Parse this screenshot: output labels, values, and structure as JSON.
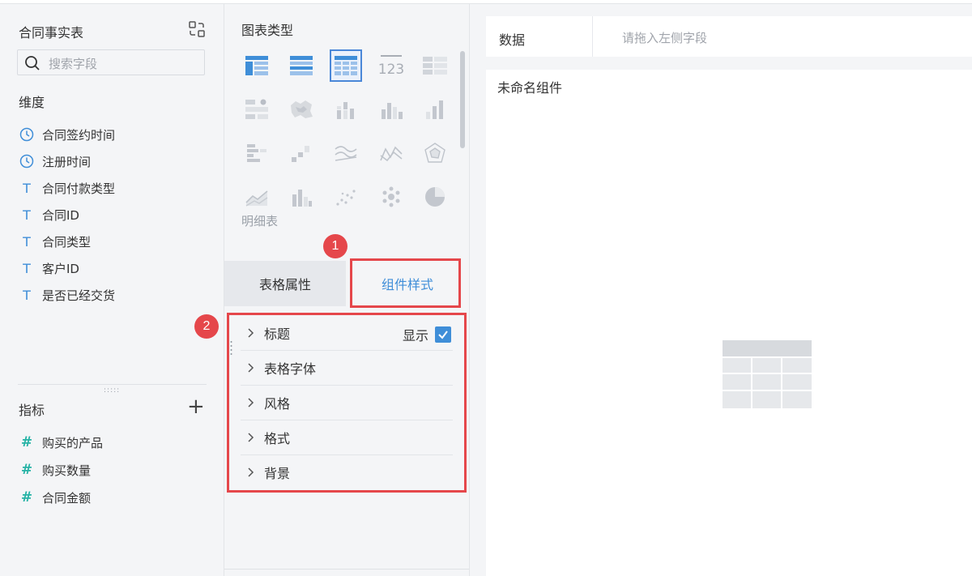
{
  "dataset": {
    "title": "合同事实表"
  },
  "search": {
    "placeholder": "搜索字段"
  },
  "dimensions": {
    "label": "维度",
    "items": [
      {
        "label": "合同签约时间",
        "icon": "clock-icon"
      },
      {
        "label": "注册时间",
        "icon": "clock-icon"
      },
      {
        "label": "合同付款类型",
        "icon": "T"
      },
      {
        "label": "合同ID",
        "icon": "T"
      },
      {
        "label": "合同类型",
        "icon": "T"
      },
      {
        "label": "客户ID",
        "icon": "T"
      },
      {
        "label": "是否已经交货",
        "icon": "T"
      }
    ]
  },
  "measures": {
    "label": "指标",
    "items": [
      {
        "label": "购买的产品",
        "icon": "#"
      },
      {
        "label": "购买数量",
        "icon": "#"
      },
      {
        "label": "合同金额",
        "icon": "#"
      }
    ]
  },
  "chart_types": {
    "title": "图表类型",
    "selected_caption": "明细表",
    "icon_names": [
      "grouped-table-icon",
      "cross-table-icon",
      "detail-table-icon",
      "kpi-number-icon",
      "kpi-card-icon",
      "filter-list-icon",
      "map-icon",
      "stacked-column-icon",
      "column-icon",
      "sorted-column-icon",
      "bar-icon",
      "step-column-icon",
      "line-icon",
      "zigzag-line-icon",
      "radar-icon",
      "area-icon",
      "combo-icon",
      "scatter-icon",
      "bubble-icon",
      "pie-icon"
    ]
  },
  "tabs": {
    "table_props": "表格属性",
    "component_style": "组件样式"
  },
  "style_sections": [
    {
      "label": "标题"
    },
    {
      "label": "表格字体"
    },
    {
      "label": "风格"
    },
    {
      "label": "格式"
    },
    {
      "label": "背景"
    }
  ],
  "title_show": {
    "label": "显示",
    "checked": true
  },
  "annotations": {
    "badge1": "1",
    "badge2": "2"
  },
  "data_bar": {
    "label": "数据",
    "placeholder": "请拖入左侧字段"
  },
  "canvas": {
    "title": "未命名组件"
  },
  "colors": {
    "accent": "#3f8ed8",
    "annotation_red": "#e5474b",
    "measure_teal": "#27b3a6"
  }
}
